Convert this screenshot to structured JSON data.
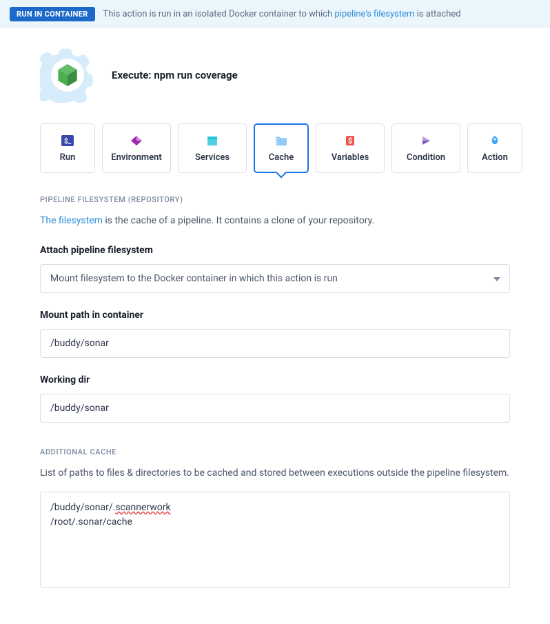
{
  "banner": {
    "badge": "RUN IN CONTAINER",
    "text_before": "This action is run in an isolated Docker container to which ",
    "link_text": "pipeline's filesystem",
    "text_after": " is attached"
  },
  "header": {
    "title": "Execute: npm run coverage"
  },
  "tabs": [
    {
      "label": "Run"
    },
    {
      "label": "Environment"
    },
    {
      "label": "Services"
    },
    {
      "label": "Cache"
    },
    {
      "label": "Variables"
    },
    {
      "label": "Condition"
    },
    {
      "label": "Action"
    }
  ],
  "filesystem_section": {
    "header": "PIPELINE FILESYSTEM (REPOSITORY)",
    "desc_link": "The filesystem",
    "desc_rest": " is the cache of a pipeline. It contains a clone of your repository.",
    "attach_label": "Attach pipeline filesystem",
    "attach_value": "Mount filesystem to the Docker container in which this action is run",
    "mount_label": "Mount path in container",
    "mount_value": "/buddy/sonar",
    "workdir_label": "Working dir",
    "workdir_value": "/buddy/sonar"
  },
  "additional_cache": {
    "header": "ADDITIONAL CACHE",
    "desc": "List of paths to files & directories to be cached and stored between executions outside the pipeline filesystem.",
    "line1_prefix": "/buddy/sonar/.",
    "line1_squiggle": "scannerwork",
    "line2": "/root/.sonar/cache"
  }
}
